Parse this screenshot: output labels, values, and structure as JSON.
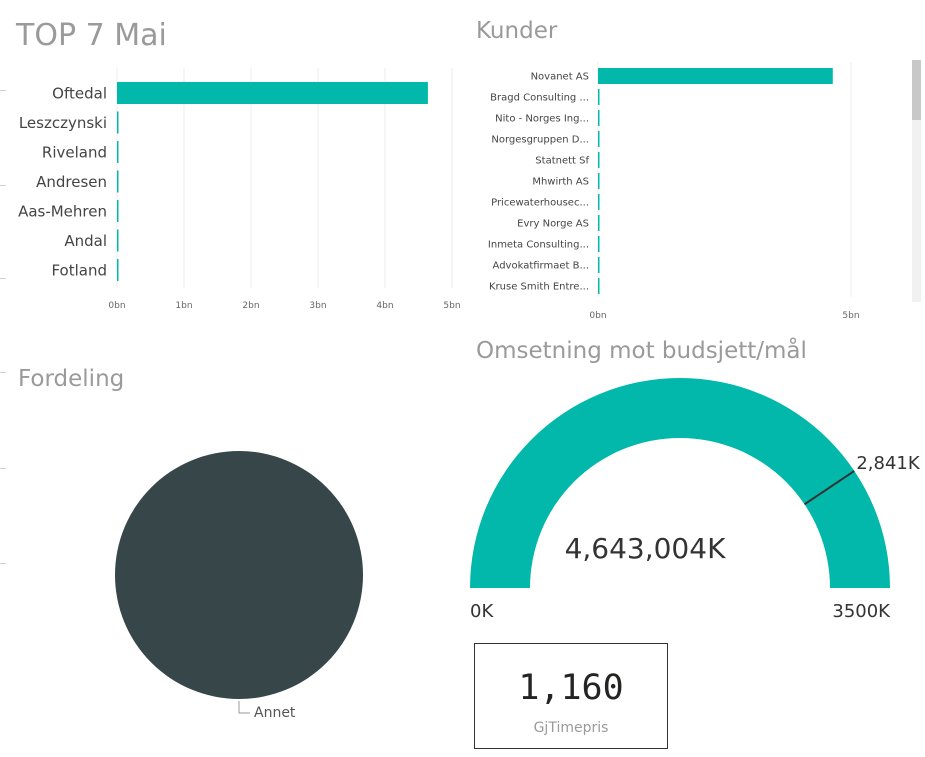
{
  "colors": {
    "accent": "#01b8aa",
    "dark": "#374649",
    "title": "#9a9a9a"
  },
  "top7": {
    "title": "TOP 7 Mai",
    "ticks": [
      "0bn",
      "1bn",
      "2bn",
      "3bn",
      "4bn",
      "5bn"
    ],
    "chart_data": {
      "type": "bar",
      "orientation": "horizontal",
      "categories": [
        "Oftedal",
        "Leszczynski",
        "Riveland",
        "Andresen",
        "Aas-Mehren",
        "Andal",
        "Fotland"
      ],
      "values": [
        4.64,
        0.01,
        0.01,
        0.01,
        0.01,
        0.01,
        0.01
      ],
      "xlim": [
        0,
        5
      ],
      "unit": "bn",
      "grid": true
    }
  },
  "kunder": {
    "title": "Kunder",
    "ticks": [
      "0bn",
      "5bn"
    ],
    "chart_data": {
      "type": "bar",
      "orientation": "horizontal",
      "categories": [
        "Novanet AS",
        "Bragd Consulting ...",
        "Nito - Norges Ing...",
        "Norgesgruppen D...",
        "Statnett Sf",
        "Mhwirth AS",
        "Pricewaterhousec...",
        "Evry Norge AS",
        "Inmeta Consulting...",
        "Advokatfirmaet B...",
        "Kruse Smith Entre..."
      ],
      "values": [
        4.64,
        0.01,
        0.01,
        0.01,
        0.01,
        0.01,
        0.01,
        0.01,
        0.01,
        0.01,
        0.01
      ],
      "xlim": [
        0,
        5
      ],
      "unit": "bn",
      "grid": true
    }
  },
  "fordeling": {
    "title": "Fordeling",
    "chart_data": {
      "type": "pie",
      "slices": [
        {
          "label": "Annet",
          "share": 1.0,
          "color": "#374649"
        }
      ]
    }
  },
  "gauge": {
    "title": "Omsetning mot budsjett/mål",
    "value_label": "4,643,004K",
    "target_label": "2,841K",
    "min_label": "0K",
    "max_label": "3500K",
    "chart_data": {
      "type": "gauge",
      "value": 4643004,
      "target": 2841,
      "min": 0,
      "max": 3500,
      "unit": "K"
    }
  },
  "card": {
    "value": "1,160",
    "label": "GjTimepris"
  }
}
